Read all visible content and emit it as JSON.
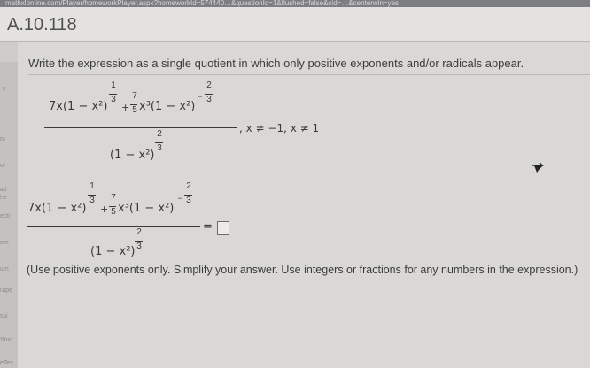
{
  "browser": {
    "url_fragment": "mathxlonline.com/Player/homeworkPlayer.aspx?homeworkId=574440…&questionId=1&flushed=false&cid=…&centerwin=yes"
  },
  "header": {
    "exercise_id": "A.10.118"
  },
  "sidebar": {
    "fragments": [
      "c",
      "m",
      "ur",
      "ati",
      "he",
      "ecti",
      "om",
      "um",
      "rape",
      "ssi",
      "Stud",
      "eTex"
    ]
  },
  "question": {
    "prompt": "Write the expression as a single quotient in which only positive exponents and/or radicals appear.",
    "expr": {
      "term1": "7x(1 − x²)",
      "exp1_num": "1",
      "exp1_den": "3",
      "plus": "+",
      "coef_num": "7",
      "coef_den": "5",
      "term2": "x³(1 − x²)",
      "exp2_sign": "−",
      "exp2_num": "2",
      "exp2_den": "3",
      "denominator": "(1 − x²)",
      "den_exp_num": "2",
      "den_exp_den": "3",
      "restriction": ", x ≠ −1, x ≠ 1"
    },
    "answer": {
      "equals": "=",
      "value": ""
    },
    "instruction": "(Use positive exponents only. Simplify your answer. Use integers or fractions for any numbers in the expression.)"
  },
  "icons": {
    "cursor": "mouse-pointer-icon"
  }
}
